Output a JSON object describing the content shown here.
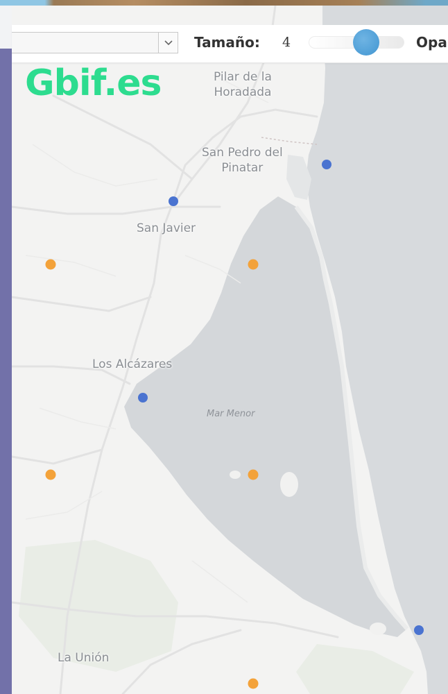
{
  "controls": {
    "size_label": "Tamaño:",
    "size_value": "4",
    "opacity_label": "Opa",
    "select_icon": "chevron-down-icon"
  },
  "logo": {
    "text": "Gbif.es"
  },
  "map": {
    "places": [
      {
        "name": "Pilar de la",
        "name2": "Horadada"
      },
      {
        "name": "San Pedro del",
        "name2": "Pinatar"
      },
      {
        "name": "San Javier"
      },
      {
        "name": "Los Alcázares"
      },
      {
        "name": "La Unión"
      }
    ],
    "water_label": "Mar Menor"
  },
  "colors": {
    "sidebar": "#7271a9",
    "logo": "#2ddc8f",
    "sea": "#d6d9dc",
    "marker_blue": "#4a73d0",
    "marker_orange": "#f3a23a",
    "slider_thumb": "#4f9fd7"
  }
}
